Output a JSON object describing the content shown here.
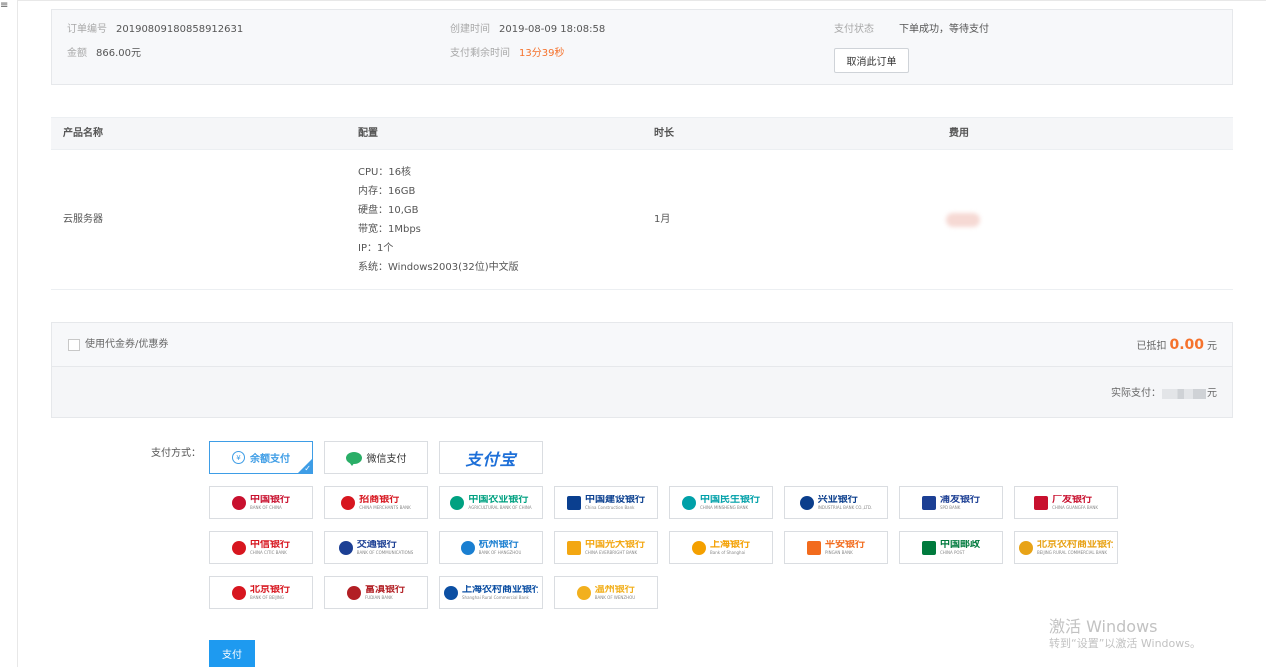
{
  "order": {
    "order_no_label": "订单编号",
    "order_no": "20190809180858912631",
    "amount_label": "金额",
    "amount": "866.00元",
    "created_label": "创建时间",
    "created": "2019-08-09 18:08:58",
    "remaining_label": "支付剩余时间",
    "remaining": "13分39秒",
    "status_label": "支付状态",
    "status": "下单成功，等待支付",
    "cancel_label": "取消此订单"
  },
  "product_table": {
    "headers": [
      "产品名称",
      "配置",
      "时长",
      "费用"
    ],
    "row": {
      "name": "云服务器",
      "config": [
        "CPU：16核",
        "内存：16GB",
        "硬盘：10,GB",
        "带宽：1Mbps",
        "IP：1个",
        "系统：Windows2003(32位)中文版"
      ],
      "duration": "1月"
    }
  },
  "coupon": {
    "label": "使用代金券/优惠券",
    "deducted_label": "已抵扣",
    "deducted_amount": "0.00",
    "deducted_unit": "元"
  },
  "actual": {
    "label": "实际支付：",
    "unit": "元"
  },
  "payment": {
    "label": "支付方式：",
    "methods": [
      {
        "label": "余额支付",
        "icon": "wallet-icon",
        "selected": true
      },
      {
        "label": "微信支付",
        "icon": "wechat-icon",
        "selected": false
      },
      {
        "label": "支付宝",
        "icon": "alipay-logo",
        "selected": false
      }
    ],
    "banks": [
      {
        "cn": "中国银行",
        "en": "BANK OF CHINA",
        "color": "#c8102e"
      },
      {
        "cn": "招商银行",
        "en": "CHINA MERCHANTS BANK",
        "color": "#d7161f"
      },
      {
        "cn": "中国农业银行",
        "en": "AGRICULTURAL BANK OF CHINA",
        "color": "#00a181"
      },
      {
        "cn": "中国建设银行",
        "en": "China Construction Bank",
        "color": "#0a3f8f"
      },
      {
        "cn": "中国民生银行",
        "en": "CHINA MINSHENG BANK",
        "color": "#00a0a8"
      },
      {
        "cn": "兴业银行",
        "en": "INDUSTRIAL BANK CO.,LTD.",
        "color": "#0b3e8c"
      },
      {
        "cn": "浦发银行",
        "en": "SPD BANK",
        "color": "#1c3f94"
      },
      {
        "cn": "广发银行",
        "en": "CHINA GUANGFA BANK",
        "color": "#c8102e"
      },
      {
        "cn": "中信银行",
        "en": "CHINA CITIC BANK",
        "color": "#d7161f"
      },
      {
        "cn": "交通银行",
        "en": "BANK OF COMMUNICATIONS",
        "color": "#1c3f94"
      },
      {
        "cn": "杭州银行",
        "en": "BANK OF HANGZHOU",
        "color": "#1a7fd1"
      },
      {
        "cn": "中国光大银行",
        "en": "CHINA EVERBRIGHT BANK",
        "color": "#f3a712"
      },
      {
        "cn": "上海银行",
        "en": "Bank of Shanghai",
        "color": "#f4a000"
      },
      {
        "cn": "平安银行",
        "en": "PINGAN BANK",
        "color": "#f26b1d"
      },
      {
        "cn": "中国邮政",
        "en": "CHINA POST",
        "color": "#007a3d"
      },
      {
        "cn": "北京农村商业银行",
        "en": "BEIJING RURAL COMMERCIAL BANK",
        "color": "#e8a317"
      },
      {
        "cn": "北京银行",
        "en": "BANK OF BEIJING",
        "color": "#d7161f"
      },
      {
        "cn": "富滇银行",
        "en": "FUDIAN BANK",
        "color": "#b21f24"
      },
      {
        "cn": "上海农村商业银行",
        "en": "Shanghai Rural Commercial Bank",
        "color": "#0c4fa3"
      },
      {
        "cn": "温州银行",
        "en": "BANK OF WENZHOU",
        "color": "#f2b01e"
      }
    ],
    "submit_label": "支付"
  },
  "watermark": {
    "line1": "激活 Windows",
    "line2": "转到“设置”以激活 Windows。"
  },
  "sidebar": {
    "toggle_icon": "≡"
  }
}
